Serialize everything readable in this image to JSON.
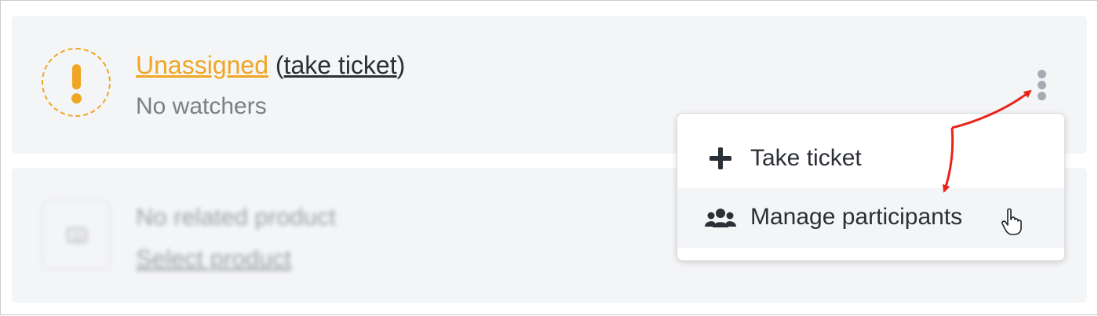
{
  "assignment": {
    "status_label": "Unassigned",
    "paren_open": "(",
    "take_link": "take ticket",
    "paren_close": ")",
    "watchers_text": "No watchers",
    "status_color": "#f0a623",
    "status_icon": "exclamation-icon"
  },
  "product": {
    "title": "No related product",
    "link": "Select product",
    "icon": "camera-icon"
  },
  "more_menu": {
    "trigger_icon": "kebab-vertical-icon",
    "items": [
      {
        "label": "Take ticket",
        "icon": "plus-icon"
      },
      {
        "label": "Manage participants",
        "icon": "users-icon"
      }
    ]
  },
  "annotations": {
    "arrow_color": "#e8231a"
  }
}
